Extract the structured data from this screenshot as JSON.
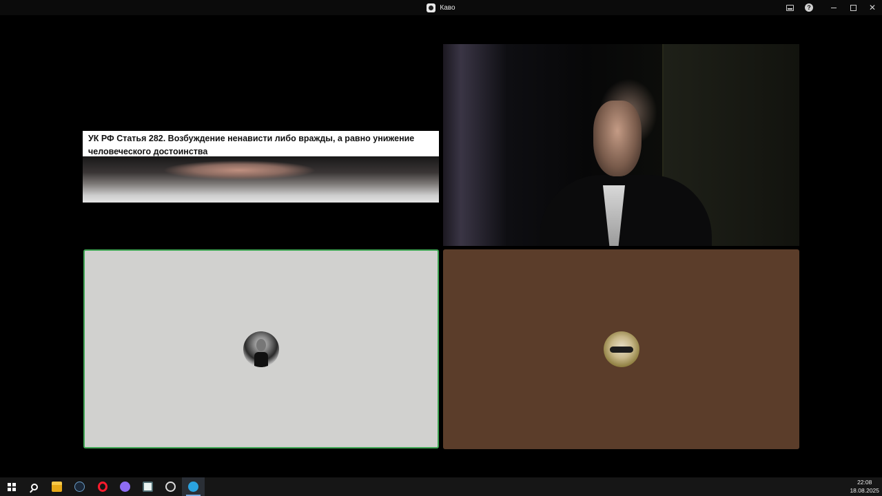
{
  "window": {
    "title": "Каво",
    "icons": [
      "stage-icon",
      "help-icon",
      "minimize-icon",
      "maximize-icon",
      "close-icon"
    ]
  },
  "call": {
    "screen_share": {
      "caption": "УК РФ Статья 282. Возбуждение ненависти либо вражды, а равно унижение человеческого достоинства"
    },
    "participants": [
      {
        "kind": "camera"
      },
      {
        "kind": "avatar",
        "tile_color": "#d1d1cf",
        "speaking": true,
        "border_color": "#3fa654"
      },
      {
        "kind": "avatar",
        "tile_color": "#5b3d2a",
        "speaking": false
      }
    ]
  },
  "taskbar": {
    "apps": [
      "windows-start",
      "search",
      "file-explorer",
      "steam",
      "opera",
      "discord",
      "window-app",
      "obs",
      "telegram"
    ],
    "active_app": "telegram",
    "time": "22:08",
    "date": "18.08.2025"
  }
}
